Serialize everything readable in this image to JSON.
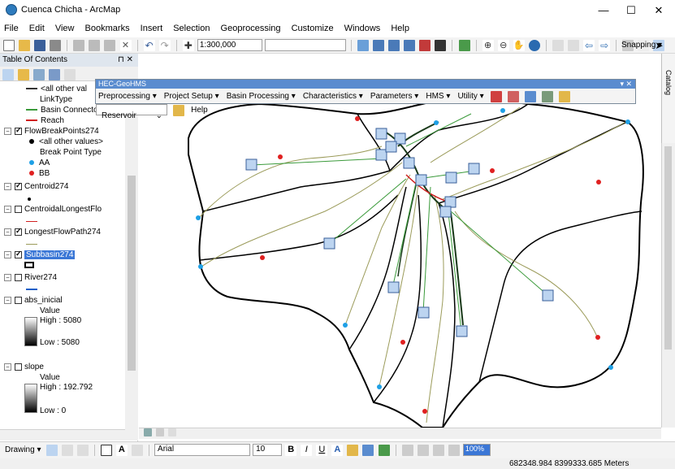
{
  "window": {
    "title": "Cuenca Chicha - ArcMap",
    "minimize": "—",
    "maximize": "☐",
    "close": "✕"
  },
  "menu": [
    "File",
    "Edit",
    "View",
    "Bookmarks",
    "Insert",
    "Selection",
    "Geoprocessing",
    "Customize",
    "Windows",
    "Help"
  ],
  "toolbar": {
    "scale": "1:300,000",
    "snapping": "Snapping ▾"
  },
  "toc": {
    "title": "Table Of Contents",
    "pin": "⊓ ✕",
    "rows": {
      "other_vals": "<all other val",
      "linktype": "LinkType",
      "basin_connector": "Basin Connector",
      "reach": "Reach",
      "fbp": "FlowBreakPoints274",
      "fbp_other": "<all other values>",
      "fbp_type": "Break Point Type",
      "aa": "AA",
      "bb": "BB",
      "centroid": "Centroid274",
      "centroidal": "CentroidalLongestFlo",
      "lfp": "LongestFlowPath274",
      "subbasin": "Subbasin274",
      "river": "River274",
      "abs": "abs_inicial",
      "abs_value": "Value",
      "abs_high": "High : 5080",
      "abs_low": "Low : 5080",
      "slope": "slope",
      "slope_value": "Value",
      "slope_high": "High : 192.792",
      "slope_low": "Low : 0"
    }
  },
  "hec": {
    "title": "HEC-GeoHMS",
    "menus": [
      "Preprocessing ▾",
      "Project Setup ▾",
      "Basin Processing ▾",
      "Characteristics ▾",
      "Parameters ▾",
      "HMS ▾",
      "Utility ▾"
    ],
    "dropdown": "Reservoir",
    "help": "Help"
  },
  "catalog": "Catalog",
  "bottom": {
    "drawing": "Drawing ▾",
    "font": "Arial",
    "size": "10",
    "zoom": "100%"
  },
  "status": {
    "coords": "682348.984  8399333.685 Meters"
  },
  "colors": {
    "aa": "#1ea0e6",
    "bb": "#e02020",
    "reach": "#d02020",
    "connector": "#3a9a3a",
    "subbasin": "#000000",
    "flowpath": "#9b9b5a"
  }
}
